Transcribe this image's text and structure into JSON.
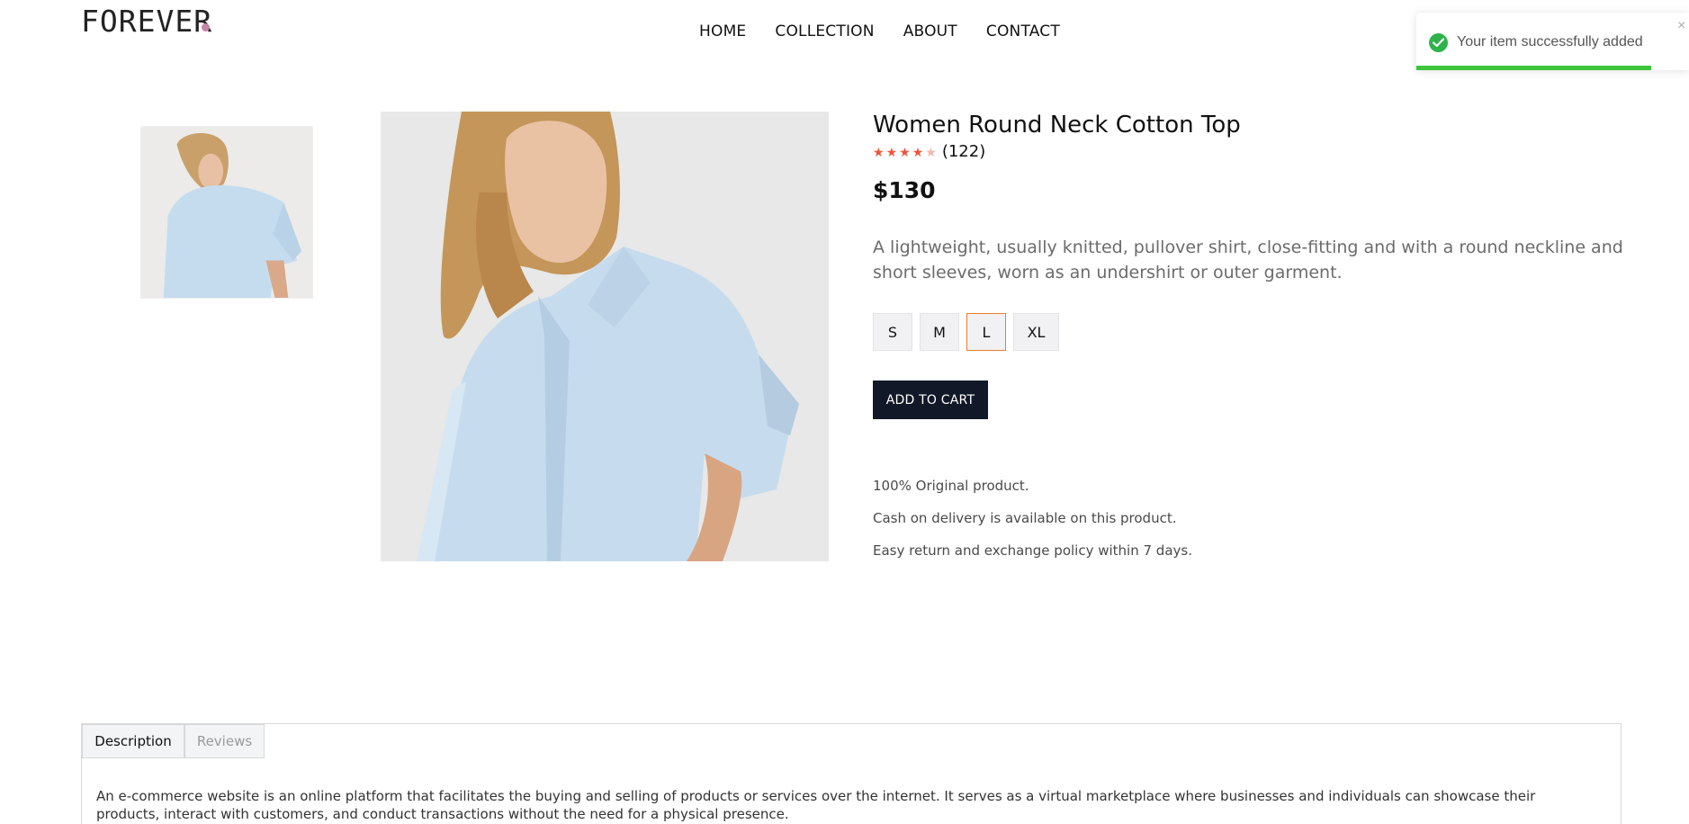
{
  "header": {
    "logo_text": "FOREVER",
    "nav": [
      "HOME",
      "COLLECTION",
      "ABOUT",
      "CONTACT"
    ]
  },
  "toast": {
    "message": "Your item successfully added",
    "close_symbol": "×",
    "progress_fraction": 0.86,
    "accent_color": "#3ec63b"
  },
  "product": {
    "title": "Women Round Neck Cotton Top",
    "rating_stars": 4,
    "rating_max": 5,
    "rating_count": "(122)",
    "price": "$130",
    "description": "A lightweight, usually knitted, pullover shirt, close-fitting and with a round neckline and short sleeves, worn as an undershirt or outer garment.",
    "sizes": [
      "S",
      "M",
      "L",
      "XL"
    ],
    "selected_size": "L",
    "add_to_cart": "ADD TO CART",
    "features": [
      "100% Original product.",
      "Cash on delivery is available on this product.",
      "Easy return and exchange policy within 7 days."
    ]
  },
  "tabs": {
    "items": [
      "Description",
      "Reviews"
    ],
    "active": "Description",
    "body": "An e-commerce website is an online platform that facilitates the buying and selling of products or services over the internet. It serves as a virtual marketplace where businesses and individuals can showcase their products, interact with customers, and conduct transactions without the need for a physical presence."
  },
  "colors": {
    "star": "#f0533b",
    "button_bg": "#111827",
    "selected_size_border": "#f07c2c",
    "logo_dot": "#c586a5"
  }
}
